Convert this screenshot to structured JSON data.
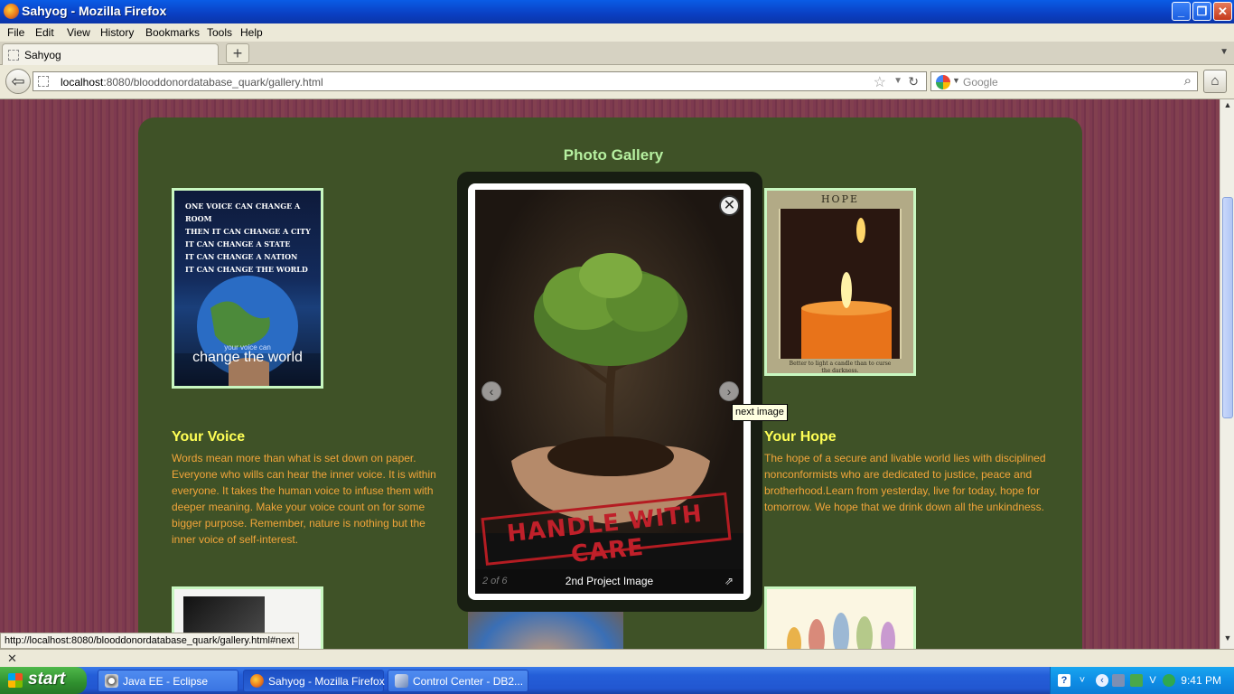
{
  "window": {
    "title": "Sahyog - Mozilla Firefox"
  },
  "menu": [
    "File",
    "Edit",
    "View",
    "History",
    "Bookmarks",
    "Tools",
    "Help"
  ],
  "tab": {
    "label": "Sahyog"
  },
  "address": {
    "host": "localhost",
    "rest": ":8080/blooddonordatabase_quark/gallery.html"
  },
  "search": {
    "placeholder": "Google"
  },
  "page": {
    "gallery_title": "Photo Gallery",
    "left": {
      "heading": "Your Voice",
      "text": "Words mean more than what is set down on paper. Everyone who wills can hear the inner voice. It is within everyone. It takes the human voice to infuse them with deeper meaning. Make your voice count on for some bigger purpose. Remember, nature is nothing but the inner voice of self-interest.",
      "poster_lines": [
        "ONE VOICE CAN CHANGE A ROOM",
        "THEN IT CAN CHANGE A CITY",
        "IT CAN CHANGE A STATE",
        "IT CAN CHANGE A NATION",
        "IT CAN CHANGE THE WORLD"
      ],
      "poster_bottom_small": "your voice can",
      "poster_bottom_big": "change the world"
    },
    "right": {
      "heading": "Your Hope",
      "text": "The hope of a secure and livable world lies with disciplined nonconformists who are dedicated to justice, peace and brotherhood.Learn from yesterday, live for today, hope for tomorrow. We hope that we drink down all the unkindness.",
      "poster_title": "HOPE",
      "poster_caption": "Better to light a candle than to curse the darkness."
    }
  },
  "lightbox": {
    "counter": "2 of 6",
    "title": "2nd Project Image",
    "stamp": "HANDLE WITH CARE",
    "tooltip": "next image"
  },
  "status": {
    "url": "http://localhost:8080/blooddonordatabase_quark/gallery.html#next"
  },
  "taskbar": {
    "start": "start",
    "tasks": [
      "Java EE - Eclipse",
      "Sahyog - Mozilla Firefox",
      "Control Center - DB2..."
    ],
    "clock": "9:41 PM"
  }
}
